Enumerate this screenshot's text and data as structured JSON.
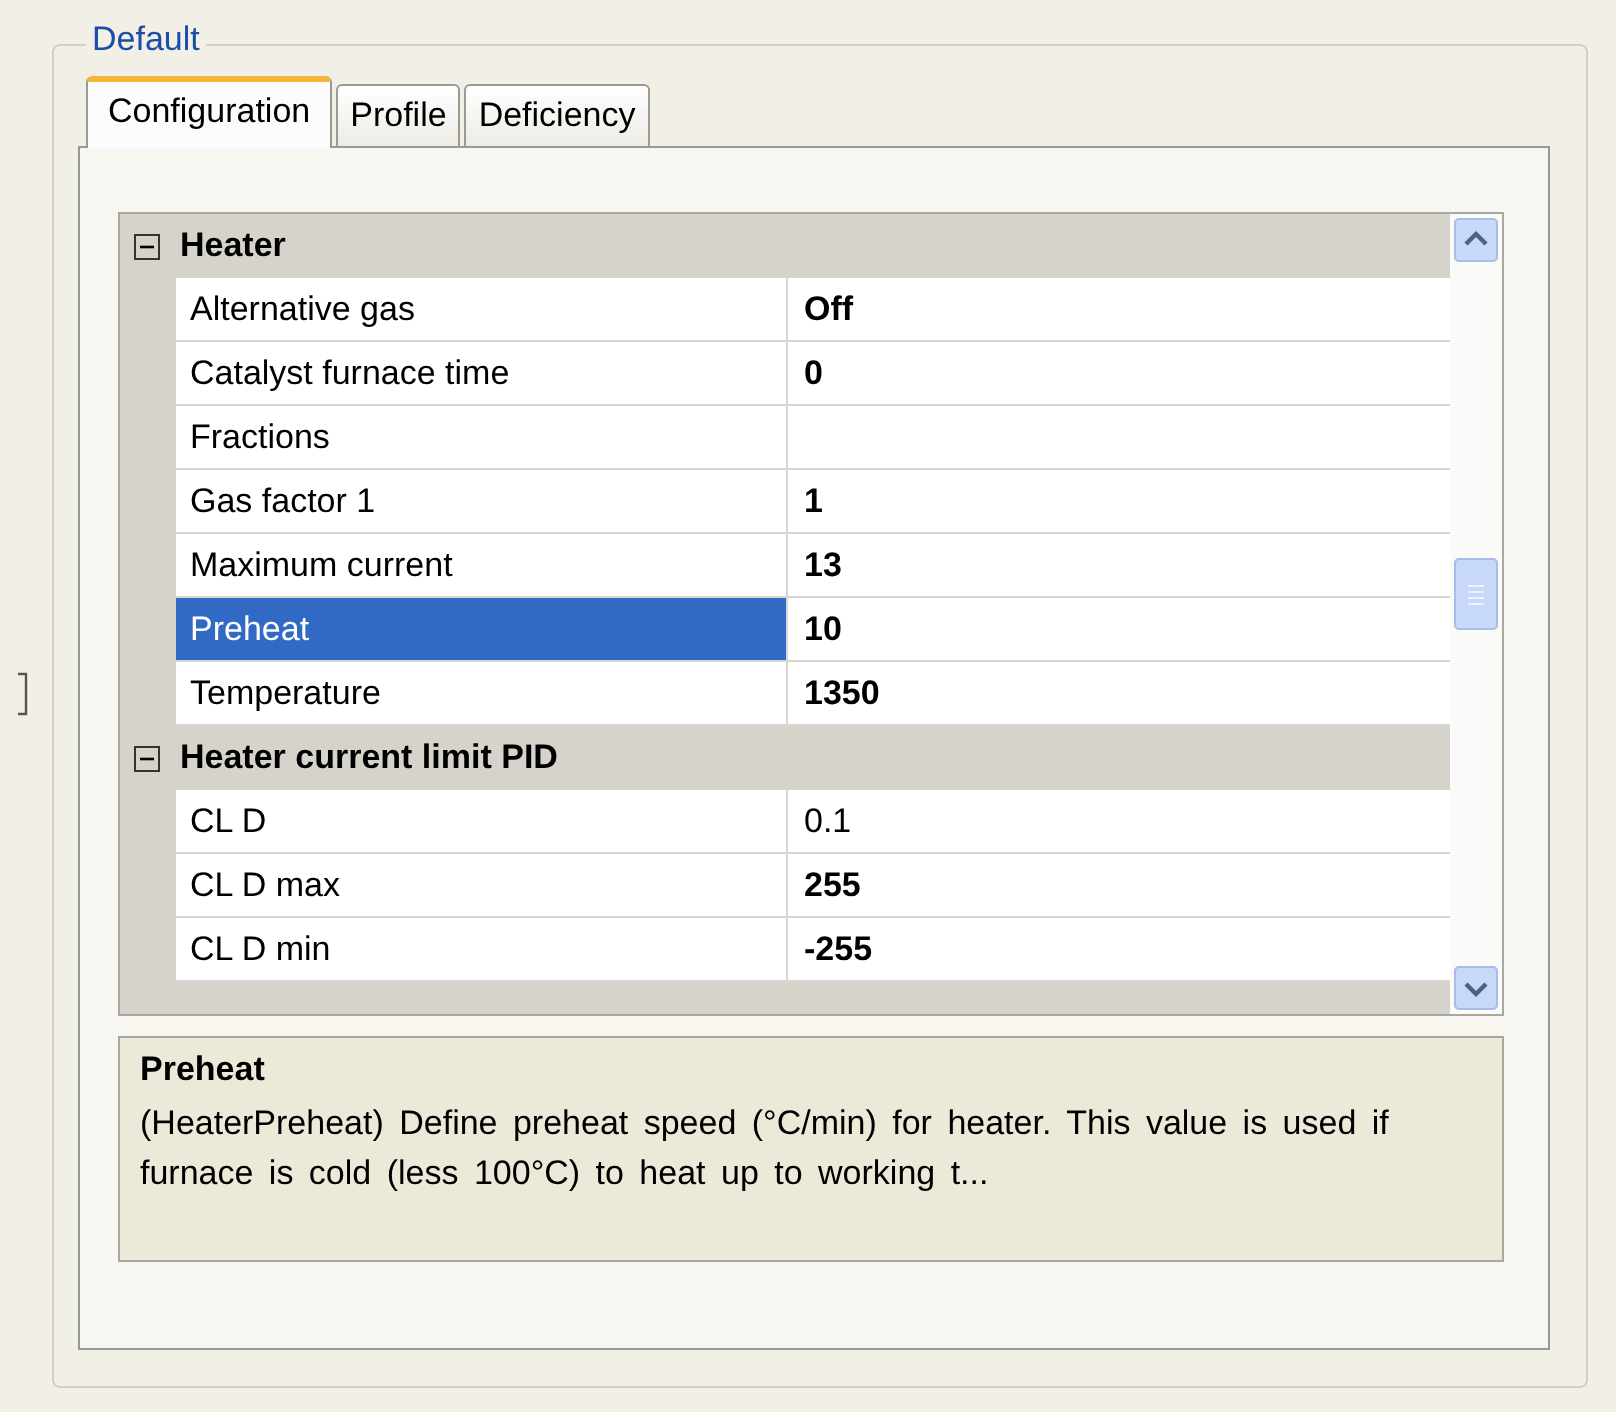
{
  "group": {
    "title": "Default"
  },
  "tabs": [
    {
      "label": "Configuration",
      "selected": true
    },
    {
      "label": "Profile",
      "selected": false
    },
    {
      "label": "Deficiency",
      "selected": false
    }
  ],
  "categories": [
    {
      "name": "Heater",
      "expanded": true,
      "properties": [
        {
          "name": "Alternative gas",
          "value": "Off",
          "modified": true,
          "selected": false
        },
        {
          "name": "Catalyst furnace time",
          "value": "0",
          "modified": true,
          "selected": false
        },
        {
          "name": "Fractions",
          "modified": false,
          "selected": false
        },
        {
          "name": "Gas factor 1",
          "value": "1",
          "modified": true,
          "selected": false
        },
        {
          "name": "Maximum current",
          "value": "13",
          "modified": true,
          "selected": false
        },
        {
          "name": "Preheat",
          "value": "10",
          "modified": true,
          "selected": true
        },
        {
          "name": "Temperature",
          "value": "1350",
          "modified": true,
          "selected": false
        }
      ]
    },
    {
      "name": "Heater current limit PID",
      "expanded": true,
      "properties": [
        {
          "name": "CL D",
          "value": "0.1",
          "modified": false,
          "selected": false
        },
        {
          "name": "CL D max",
          "value": "255",
          "modified": true,
          "selected": false
        },
        {
          "name": "CL D min",
          "value": "-255",
          "modified": true,
          "selected": false
        }
      ]
    }
  ],
  "help": {
    "title": "Preheat",
    "text": "(HeaterPreheat) Define preheat speed (°C/min) for heater. This value is used if furnace is cold (less 100°C) to heat up to working t..."
  }
}
